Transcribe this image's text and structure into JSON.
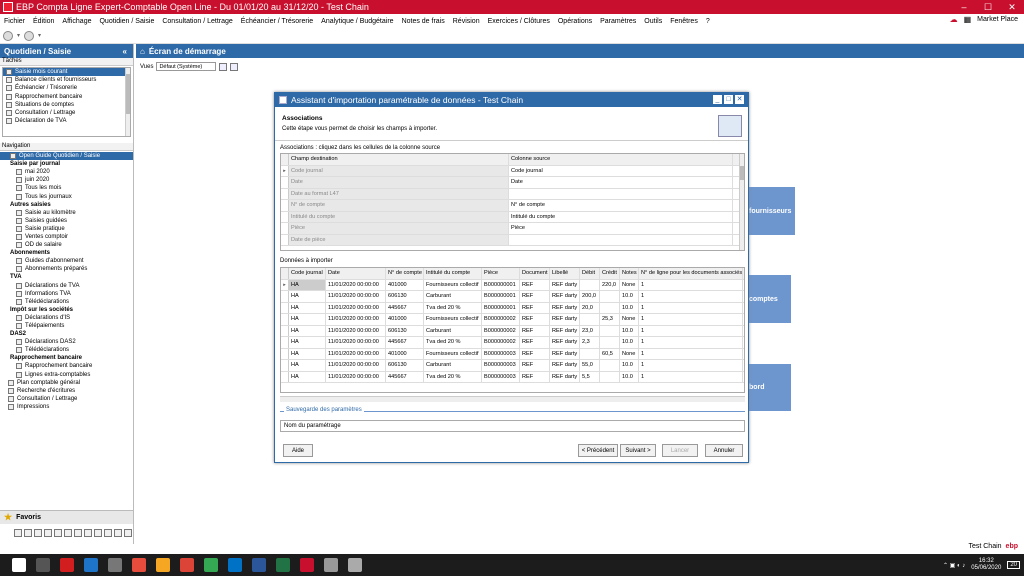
{
  "window": {
    "title": "EBP Compta Ligne Expert-Comptable Open Line - Du 01/01/20 au 31/12/20 - Test Chain"
  },
  "menu": {
    "items": [
      "Fichier",
      "Édition",
      "Affichage",
      "Quotidien / Saisie",
      "Consultation / Lettrage",
      "Échéancier / Trésorerie",
      "Analytique / Budgétaire",
      "Notes de frais",
      "Révision",
      "Exercices / Clôtures",
      "Opérations",
      "Paramètres",
      "Outils",
      "Fenêtres",
      "?"
    ],
    "market_place": "Market Place"
  },
  "left_panel": {
    "title": "Quotidien / Saisie",
    "collapse": "«",
    "tasks_label": "Tâches",
    "tasks": [
      "Saisie mois courant",
      "Balance clients et fournisseurs",
      "Échéancier / Trésorerie",
      "Rapprochement bancaire",
      "Situations de comptes",
      "Consultation / Lettrage",
      "Déclaration de TVA"
    ],
    "navigation_label": "Navigation",
    "nav": [
      {
        "label": "Open Guide Quotidien / Saisie",
        "type": "sel"
      },
      {
        "label": "Saisie par journal",
        "type": "grp"
      },
      {
        "label": "mai 2020",
        "type": "sub"
      },
      {
        "label": "juin 2020",
        "type": "sub"
      },
      {
        "label": "Tous les mois",
        "type": "sub"
      },
      {
        "label": "Tous les journaux",
        "type": "sub"
      },
      {
        "label": "Autres saisies",
        "type": "grp"
      },
      {
        "label": "Saisie au kilomètre",
        "type": "sub"
      },
      {
        "label": "Saisies guidées",
        "type": "sub"
      },
      {
        "label": "Saisie pratique",
        "type": "sub"
      },
      {
        "label": "Ventes comptoir",
        "type": "sub"
      },
      {
        "label": "OD de salaire",
        "type": "sub"
      },
      {
        "label": "Abonnements",
        "type": "grp"
      },
      {
        "label": "Guides d'abonnement",
        "type": "sub"
      },
      {
        "label": "Abonnements préparés",
        "type": "sub"
      },
      {
        "label": "TVA",
        "type": "grp"
      },
      {
        "label": "Déclarations de TVA",
        "type": "sub"
      },
      {
        "label": "Informations TVA",
        "type": "sub"
      },
      {
        "label": "Télédéclarations",
        "type": "sub"
      },
      {
        "label": "Impôt sur les sociétés",
        "type": "grp"
      },
      {
        "label": "Déclarations d'IS",
        "type": "sub"
      },
      {
        "label": "Télépaiements",
        "type": "sub"
      },
      {
        "label": "DAS2",
        "type": "grp"
      },
      {
        "label": "Déclarations DAS2",
        "type": "sub"
      },
      {
        "label": "Télédéclarations",
        "type": "sub"
      },
      {
        "label": "Rapprochement bancaire",
        "type": "grp"
      },
      {
        "label": "Rapprochement bancaire",
        "type": "sub"
      },
      {
        "label": "Lignes extra-comptables",
        "type": "sub"
      },
      {
        "label": "Plan comptable général",
        "type": "top"
      },
      {
        "label": "Recherche d'écritures",
        "type": "top"
      },
      {
        "label": "Consultation / Lettrage",
        "type": "top"
      },
      {
        "label": "Impressions",
        "type": "top"
      }
    ],
    "favorites": "Favoris"
  },
  "start_screen": {
    "title": "Écran de démarrage",
    "views_label": "Vues",
    "views_value": "Défaut (Système)",
    "tiles": [
      "fournisseurs",
      "comptes",
      "bord"
    ]
  },
  "dialog": {
    "title": "Assistant d'importation paramétrable de données - Test Chain",
    "step_title": "Associations",
    "step_desc": "Cette étape vous permet de choisir les champs à importer.",
    "assoc_label": "Associations : cliquez dans les cellules de la colonne source",
    "assoc_headers": [
      "Champ destination",
      "Colonne source"
    ],
    "assoc_rows": [
      [
        "Code journal",
        "Code journal"
      ],
      [
        "Date",
        "Date"
      ],
      [
        "Date au format L47",
        ""
      ],
      [
        "N° de compte",
        "N° de compte"
      ],
      [
        "Intitulé du compte",
        "Intitulé du compte"
      ],
      [
        "Pièce",
        "Pièce"
      ],
      [
        "Date de pièce",
        ""
      ]
    ],
    "data_label": "Données à importer",
    "data_headers": [
      "Code journal",
      "Date",
      "N° de compte",
      "Intitulé du compte",
      "Pièce",
      "Document",
      "Libellé",
      "Débit",
      "Crédit",
      "Notes",
      "N° de ligne pour les documents associés"
    ],
    "data_rows": [
      [
        "HA",
        "11/01/2020 00:00:00",
        "401000",
        "Fournisseurs collectif",
        "B000000001",
        "REF",
        "REF darty",
        "",
        "220,0",
        "None",
        "1"
      ],
      [
        "HA",
        "11/01/2020 00:00:00",
        "606130",
        "Carburant",
        "B000000001",
        "REF",
        "REF darty",
        "200,0",
        "",
        "10.0",
        "1"
      ],
      [
        "HA",
        "11/01/2020 00:00:00",
        "445667",
        "Tva ded 20 %",
        "B000000001",
        "REF",
        "REF darty",
        "20,0",
        "",
        "10.0",
        "1"
      ],
      [
        "HA",
        "11/01/2020 00:00:00",
        "401000",
        "Fournisseurs collectif",
        "B000000002",
        "REF",
        "REF darty",
        "",
        "25,3",
        "None",
        "1"
      ],
      [
        "HA",
        "11/01/2020 00:00:00",
        "606130",
        "Carburant",
        "B000000002",
        "REF",
        "REF darty",
        "23,0",
        "",
        "10.0",
        "1"
      ],
      [
        "HA",
        "11/01/2020 00:00:00",
        "445667",
        "Tva ded 20 %",
        "B000000002",
        "REF",
        "REF darty",
        "2,3",
        "",
        "10.0",
        "1"
      ],
      [
        "HA",
        "11/01/2020 00:00:00",
        "401000",
        "Fournisseurs collectif",
        "B000000003",
        "REF",
        "REF darty",
        "",
        "60,5",
        "None",
        "1"
      ],
      [
        "HA",
        "11/01/2020 00:00:00",
        "606130",
        "Carburant",
        "B000000003",
        "REF",
        "REF darty",
        "55,0",
        "",
        "10.0",
        "1"
      ],
      [
        "HA",
        "11/01/2020 00:00:00",
        "445667",
        "Tva ded 20 %",
        "B000000003",
        "REF",
        "REF darty",
        "5,5",
        "",
        "10.0",
        "1"
      ]
    ],
    "save_legend": "Sauvegarde des paramètres",
    "save_field": "Nom du paramétrage",
    "buttons": {
      "help": "Aide",
      "prev": "< Précédent",
      "next": "Suivant >",
      "launch": "Lancer",
      "cancel": "Annuler"
    }
  },
  "status": {
    "company": "Test Chain",
    "brand": "ebp"
  },
  "taskbar": {
    "time": "16:32",
    "date": "05/06/2020",
    "badge": "20"
  },
  "colors": {
    "brand_red": "#c8102e",
    "accent_blue": "#2f6aa8",
    "tile_blue": "#6d96cf"
  }
}
